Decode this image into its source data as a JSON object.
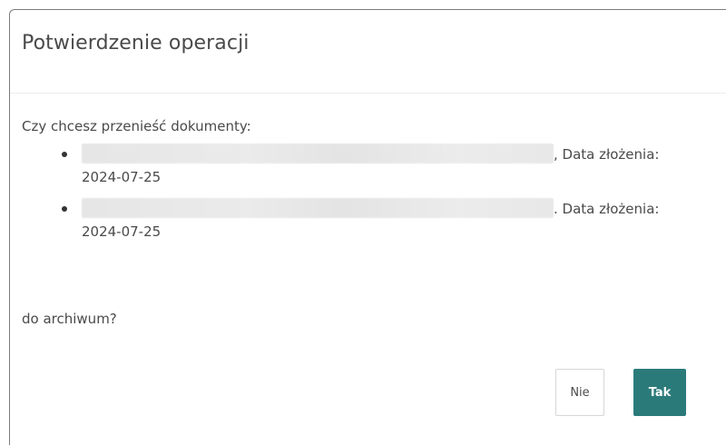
{
  "dialog": {
    "title": "Potwierdzenie operacji",
    "intro": "Czy chcesz przenieść dokumenty:",
    "documents": [
      {
        "name_redacted": true,
        "date_label": ", Data złożenia:",
        "date": "2024-07-25"
      },
      {
        "name_redacted": true,
        "date_label": ". Data złożenia:",
        "date": "2024-07-25"
      }
    ],
    "outro": "do archiwum?",
    "buttons": {
      "no": "Nie",
      "yes": "Tak"
    }
  },
  "colors": {
    "primary": "#2b7a7a",
    "text": "#4a4a4a",
    "border": "#7d7d7d"
  }
}
